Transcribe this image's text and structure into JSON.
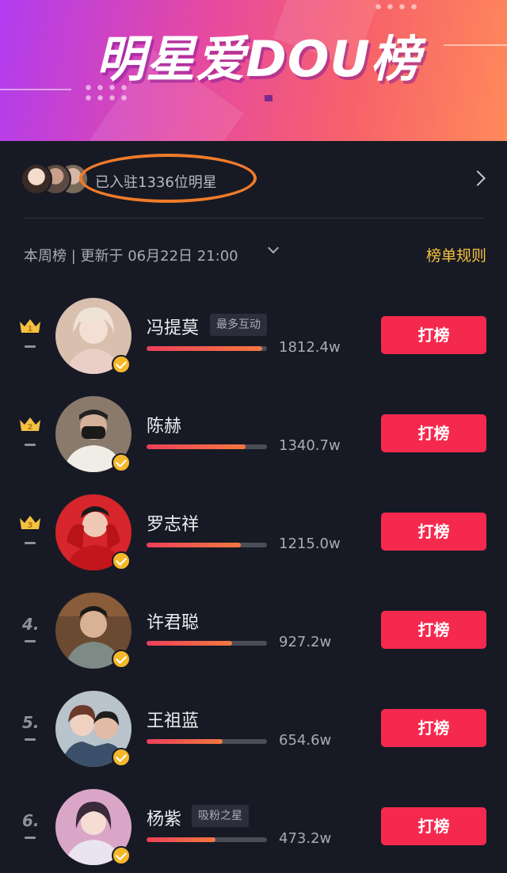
{
  "banner": {
    "title": "明星爱DOU榜"
  },
  "stars_joined": {
    "text": "已入驻1336位明星"
  },
  "week": {
    "label": "本周榜 | 更新于 06月22日 21:00",
    "rules": "榜单规则"
  },
  "colors": {
    "accent": "#f5294e",
    "gold": "#f5c141",
    "annotation": "#f07b2a"
  },
  "rankings": [
    {
      "rank": "1",
      "name": "冯提莫",
      "tag": "最多互动",
      "score": "1812.4w",
      "progress": 0.96,
      "button": "打榜"
    },
    {
      "rank": "2",
      "name": "陈赫",
      "tag": "",
      "score": "1340.7w",
      "progress": 0.82,
      "button": "打榜"
    },
    {
      "rank": "3",
      "name": "罗志祥",
      "tag": "",
      "score": "1215.0w",
      "progress": 0.78,
      "button": "打榜"
    },
    {
      "rank": "4.",
      "name": "许君聪",
      "tag": "",
      "score": "927.2w",
      "progress": 0.71,
      "button": "打榜"
    },
    {
      "rank": "5.",
      "name": "王祖蓝",
      "tag": "",
      "score": "654.6w",
      "progress": 0.63,
      "button": "打榜"
    },
    {
      "rank": "6.",
      "name": "杨紫",
      "tag": "吸粉之星",
      "score": "473.2w",
      "progress": 0.57,
      "button": "打榜"
    }
  ]
}
